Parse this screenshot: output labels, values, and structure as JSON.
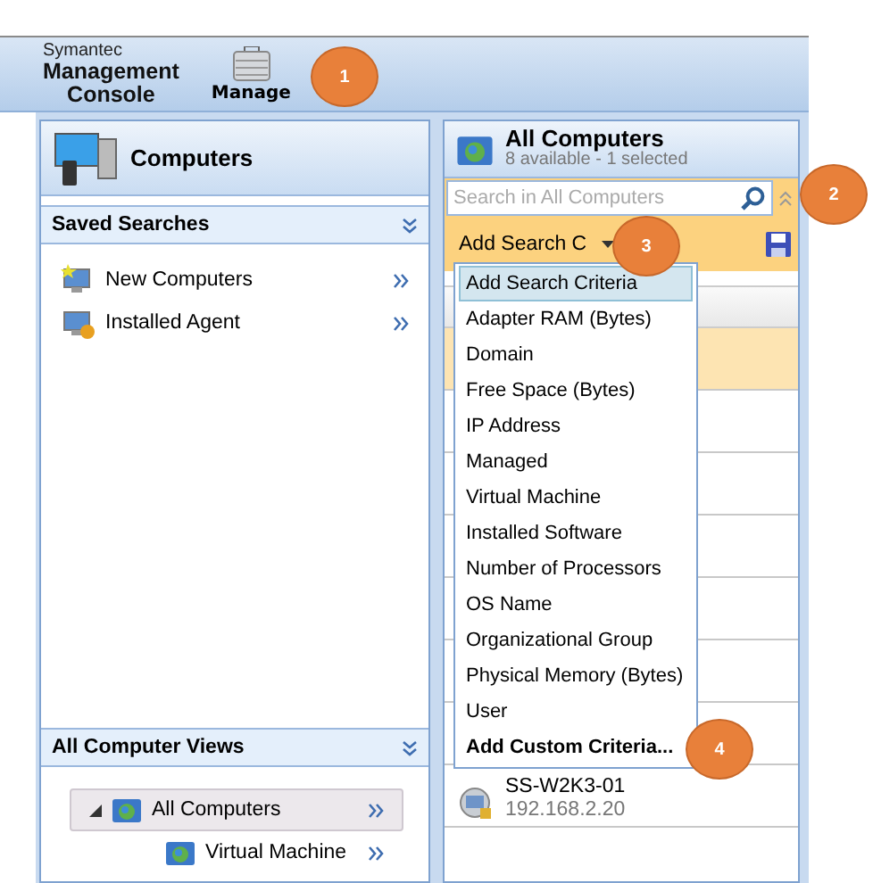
{
  "header": {
    "brand_small": "Symantec",
    "brand_line1": "Management",
    "brand_line2": "Console",
    "manage_label": "Manage"
  },
  "left_panel": {
    "title": "Computers",
    "saved_searches": {
      "title": "Saved Searches",
      "items": [
        {
          "label": "New Computers",
          "kind": "new"
        },
        {
          "label": "Installed Agent",
          "kind": "agent"
        }
      ]
    },
    "views": {
      "title": "All Computer Views",
      "tree": [
        {
          "label": "All Computers",
          "selected": true,
          "expanded": true,
          "children": [
            {
              "label": "Virtual Machine",
              "selected": false
            }
          ]
        }
      ]
    }
  },
  "right_panel": {
    "title": "All Computers",
    "subtitle": "8 available -  1 selected",
    "search": {
      "placeholder": "Search in All Computers"
    },
    "criteria_button": "Add Search C",
    "rows": [
      {
        "selected": true
      },
      {
        "selected": false
      },
      {
        "selected": false
      },
      {
        "selected": false
      },
      {
        "selected": false
      },
      {
        "selected": false
      },
      {
        "selected": false
      },
      {
        "selected": false,
        "name": "SS-W2K3-01",
        "ip": "192.168.2.20"
      }
    ]
  },
  "dropdown": {
    "items": [
      {
        "label": "Add Search Criteria",
        "selected": true,
        "kind": "option"
      },
      {
        "label": "Adapter RAM (Bytes)",
        "selected": false,
        "kind": "option"
      },
      {
        "label": "Domain",
        "selected": false,
        "kind": "option"
      },
      {
        "label": "Free Space (Bytes)",
        "selected": false,
        "kind": "option"
      },
      {
        "label": "IP Address",
        "selected": false,
        "kind": "option"
      },
      {
        "label": "Managed",
        "selected": false,
        "kind": "option"
      },
      {
        "label": "Virtual Machine",
        "selected": false,
        "kind": "option"
      },
      {
        "label": "Installed Software",
        "selected": false,
        "kind": "option"
      },
      {
        "label": "Number of Processors",
        "selected": false,
        "kind": "option"
      },
      {
        "label": "OS Name",
        "selected": false,
        "kind": "option"
      },
      {
        "label": "Organizational Group",
        "selected": false,
        "kind": "option"
      },
      {
        "label": "Physical Memory (Bytes)",
        "selected": false,
        "kind": "option"
      },
      {
        "label": "User",
        "selected": false,
        "kind": "option"
      },
      {
        "label": "Add Custom Criteria...",
        "selected": false,
        "kind": "action"
      }
    ]
  },
  "callouts": [
    "1",
    "2",
    "3",
    "4"
  ]
}
